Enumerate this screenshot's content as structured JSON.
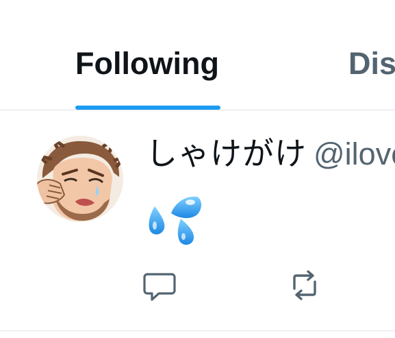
{
  "tabs": [
    {
      "label": "Following",
      "active": true
    },
    {
      "label": "Dis",
      "active": false
    }
  ],
  "colors": {
    "accent": "#1d9bf0",
    "text_primary": "#0f1419",
    "text_secondary": "#536471",
    "divider": "#dfe3e6"
  },
  "post": {
    "author": {
      "display_name": "しゃけがけ",
      "handle": "@ilove",
      "avatar_icon": "crying-man-avatar"
    },
    "content_emoji": "sweat-droplets",
    "actions": [
      {
        "icon": "reply-icon"
      },
      {
        "icon": "repost-icon"
      }
    ]
  }
}
